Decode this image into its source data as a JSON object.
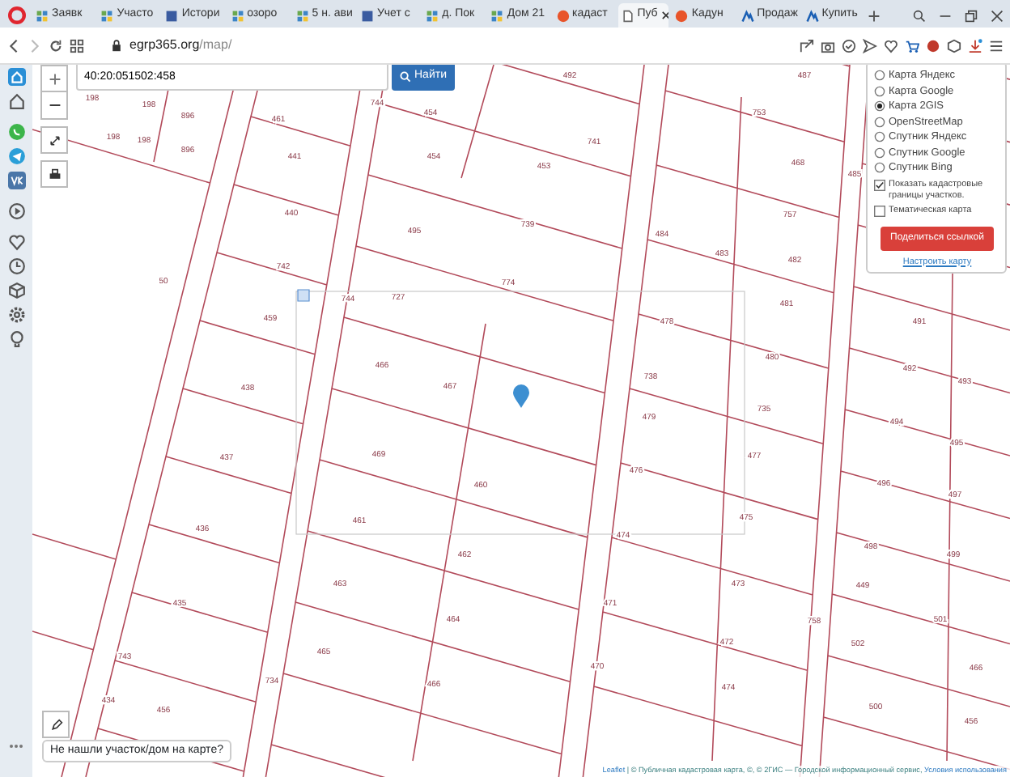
{
  "browser": {
    "tabs": [
      {
        "label": "Заявк",
        "selected": false
      },
      {
        "label": "Участо",
        "selected": false
      },
      {
        "label": "Истори",
        "selected": false
      },
      {
        "label": "озоро",
        "selected": false
      },
      {
        "label": "5 н. ави",
        "selected": false
      },
      {
        "label": "Учет с",
        "selected": false
      },
      {
        "label": "д. Пок",
        "selected": false
      },
      {
        "label": "Дом 21",
        "selected": false
      },
      {
        "label": "кадаст",
        "selected": false
      },
      {
        "label": "Пуб",
        "selected": true
      },
      {
        "label": "Кадун",
        "selected": false
      },
      {
        "label": "Продаж",
        "selected": false
      },
      {
        "label": "Купить",
        "selected": false
      }
    ],
    "address": {
      "host": "egrp365.org",
      "path": "/map/"
    }
  },
  "map": {
    "search": {
      "value": "40:20:051502:458",
      "button": "Найти"
    },
    "parcels": [
      "198",
      "198",
      "896",
      "198",
      "198",
      "896",
      "461",
      "744",
      "454",
      "492",
      "441",
      "454",
      "741",
      "453",
      "440",
      "495",
      "739",
      "742",
      "727",
      "50",
      "744",
      "774",
      "459",
      "438",
      "466",
      "467",
      "469",
      "437",
      "460",
      "461",
      "436",
      "462",
      "463",
      "435",
      "464",
      "465",
      "466",
      "743",
      "434",
      "456",
      "734",
      "753",
      "487",
      "468",
      "485",
      "757",
      "484",
      "483",
      "482",
      "481",
      "478",
      "480",
      "738",
      "479",
      "735",
      "477",
      "476",
      "474",
      "475",
      "473",
      "471",
      "472",
      "470",
      "474",
      "758",
      "491",
      "492",
      "493",
      "494",
      "495",
      "496",
      "497",
      "498",
      "499",
      "449",
      "501",
      "502",
      "500",
      "466",
      "456"
    ],
    "layers": [
      {
        "label": "Карта Яндекс",
        "selected": false
      },
      {
        "label": "Карта Google",
        "selected": false
      },
      {
        "label": "Карта 2GIS",
        "selected": true
      },
      {
        "label": "OpenStreetMap",
        "selected": false
      },
      {
        "label": "Спутник Яндекс",
        "selected": false
      },
      {
        "label": "Спутник Google",
        "selected": false
      },
      {
        "label": "Спутник Bing",
        "selected": false
      }
    ],
    "options": [
      {
        "label": "Показать кадастровые границы участков.",
        "checked": true
      },
      {
        "label": "Тематическая карта",
        "checked": false
      }
    ],
    "share_button": "Поделиться ссылкой",
    "settings_link": "Настроить карту",
    "not_found_text": "Не нашли участок/дом на карте?",
    "attribution": {
      "leaflet": "Leaflet",
      "text": "| © Публичная кадастровая карта, ©, © 2ГИС — Городской информационный сервис,",
      "terms": "Условия использования"
    }
  }
}
